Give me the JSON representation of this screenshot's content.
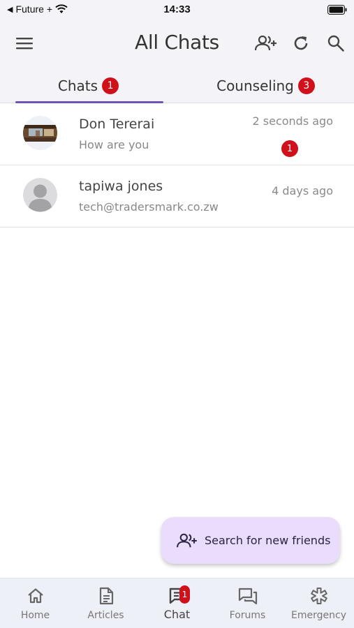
{
  "status_bar": {
    "carrier": "Future +",
    "back_arrow": "◀",
    "time": "14:33"
  },
  "header": {
    "title": "All Chats",
    "menu_icon": "hamburger-menu-icon",
    "add_friend_icon": "add-person-icon",
    "refresh_icon": "refresh-icon",
    "search_icon": "search-icon"
  },
  "tabs": [
    {
      "label": "Chats",
      "badge": "1",
      "active": true
    },
    {
      "label": "Counseling",
      "badge": "3",
      "active": false
    }
  ],
  "chats": [
    {
      "name": "Don Tererai",
      "preview": "How are you",
      "time": "2 seconds ago",
      "unread": "1"
    },
    {
      "name": "tapiwa jones",
      "preview": "tech@tradersmark.co.zw",
      "time": "4 days ago",
      "unread": ""
    }
  ],
  "fab": {
    "label": "Search for new friends",
    "icon": "add-person-icon"
  },
  "bottom_nav": [
    {
      "label": "Home",
      "icon": "home-icon"
    },
    {
      "label": "Articles",
      "icon": "document-icon"
    },
    {
      "label": "Chat",
      "icon": "chat-icon",
      "badge": "1",
      "active": true
    },
    {
      "label": "Forums",
      "icon": "forum-icon"
    },
    {
      "label": "Emergency",
      "icon": "emergency-icon"
    }
  ],
  "colors": {
    "accent": "#6e54b5",
    "badge": "#d0101a",
    "header_bg": "#f4f3f8",
    "fab_bg": "#e9ddfb"
  }
}
